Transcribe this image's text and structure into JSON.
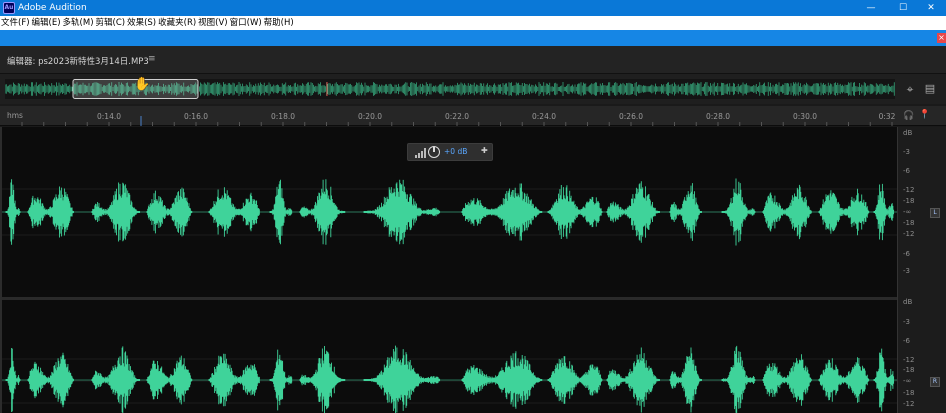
{
  "window": {
    "title": "Adobe Audition",
    "icon_text": "Au",
    "minimize": "—",
    "maximize": "☐",
    "close": "✕"
  },
  "menu": [
    "文件(F)",
    "编辑(E)",
    "多轨(M)",
    "剪辑(C)",
    "效果(S)",
    "收藏夹(R)",
    "视图(V)",
    "窗口(W)",
    "帮助(H)"
  ],
  "strip": {
    "close": "×"
  },
  "editor": {
    "title": "编辑器: ps2023新特性3月14日.MP3",
    "menu_glyph": "≡"
  },
  "ruler": {
    "unit": "hms",
    "ticks": [
      "0:14.0",
      "0:16.0",
      "0:18.0",
      "0:20.0",
      "0:22.0",
      "0:24.0",
      "0:26.0",
      "0:28.0",
      "0:30.0",
      "0:32"
    ]
  },
  "hud": {
    "value": "+0 dB"
  },
  "db_scale": {
    "top": [
      "dB",
      "-3",
      "-6",
      "-12",
      "-18",
      "-∞",
      "-18",
      "-12",
      "-6",
      "-3"
    ],
    "bottom": [
      "dB",
      "-3",
      "-6",
      "-12",
      "-18",
      "-∞",
      "-18",
      "-12"
    ],
    "left_channel": "L",
    "right_channel": "R"
  },
  "colors": {
    "waveform": "#3fd39a",
    "accent": "#0a78d7"
  },
  "icons": {
    "zoom": "zoom-navigator-icon",
    "list": "list-icon",
    "headphone": "headphone-icon",
    "pin": "pin-icon",
    "hand": "hand-cursor-icon"
  }
}
